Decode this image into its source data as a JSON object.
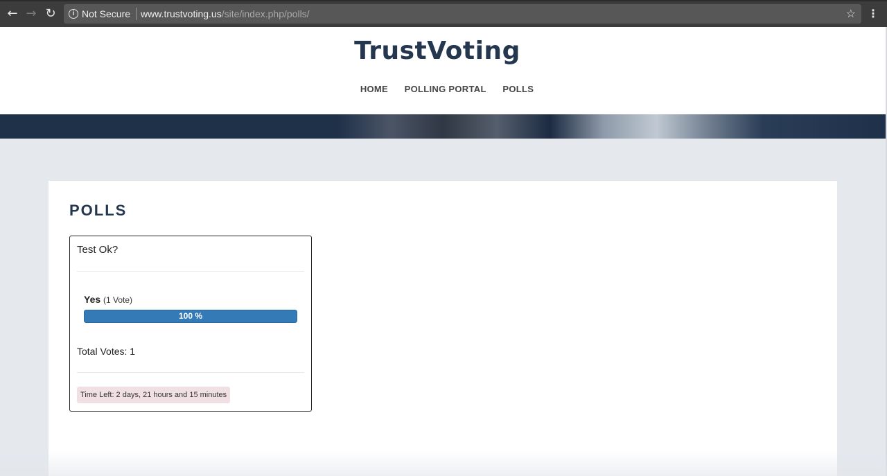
{
  "browser": {
    "back_icon": "arrow-left-icon",
    "forward_icon": "arrow-right-icon",
    "reload_icon": "reload-icon",
    "security_label": "Not Secure",
    "url_domain": "www.trustvoting.us",
    "url_path": "/site/index.php/polls/",
    "bookmark_icon": "star-icon",
    "menu_icon": "kebab-menu-icon"
  },
  "site": {
    "logo": "TrustVoting",
    "nav": [
      "HOME",
      "POLLING PORTAL",
      "POLLS"
    ]
  },
  "page": {
    "title": "POLLS"
  },
  "poll": {
    "question": "Test Ok?",
    "answer": {
      "label": "Yes",
      "votes_text": "(1 Vote)",
      "percent_text": "100 %",
      "percent": 100
    },
    "total_votes": "Total Votes: 1",
    "time_left": "Time Left: 2 days, 21 hours and 15 minutes"
  },
  "colors": {
    "brand": "#24374f",
    "progress": "#337ab7",
    "time_badge": "#f0dfe3"
  }
}
